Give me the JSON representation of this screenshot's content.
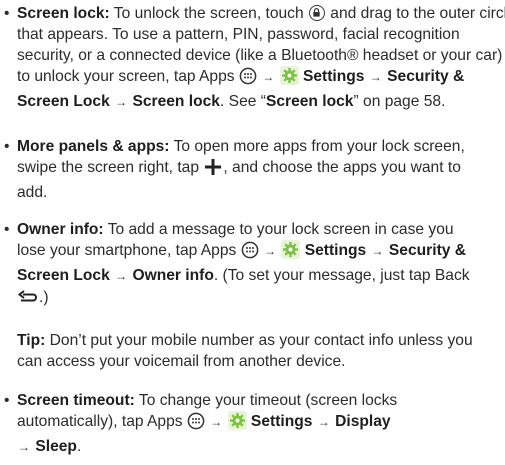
{
  "screen_lock": {
    "label": "Screen lock:",
    "t1": " To unlock the screen, touch ",
    "t2": " and drag to the outer circle that appears. To use a pattern, PIN, password, facial recognition security, or a connected device (like a Bluetooth® headset or your car) to unlock your screen, tap Apps ",
    "settings": "Settings",
    "security": "Security & Screen Lock",
    "screen_lock": "Screen lock",
    "see": ". See “",
    "ref": "Screen lock",
    "after_ref": "” on page 58."
  },
  "more_panels": {
    "label": "More panels & apps:",
    "t1": " To open more apps from your lock screen, swipe the screen right, tap ",
    "t2": ", and choose the apps you want to add."
  },
  "owner_info": {
    "label": "Owner info:",
    "t1": " To add a message to your lock screen in case you lose your smartphone, tap Apps ",
    "settings": "Settings",
    "security": "Security & Screen Lock",
    "owner": "Owner info",
    "t2": ". (To set your message, just tap Back ",
    "t3": ".)"
  },
  "tip": {
    "label": "Tip:",
    "text": " Don’t put your mobile number as your contact info unless you can access your voicemail from another device."
  },
  "screen_timeout": {
    "label": "Screen timeout:",
    "t1": " To change your timeout (screen locks automatically), tap Apps ",
    "settings": "Settings",
    "display": "Display",
    "sleep": "Sleep",
    "end": "."
  },
  "symbols": {
    "bullet": "•",
    "arrow": "→"
  },
  "icons": [
    "lock-circle-icon",
    "apps-icon",
    "settings-gear-icon",
    "plus-icon",
    "back-icon"
  ],
  "colors": {
    "text": "#2b2b2b",
    "settings_gear": "#7cc242"
  }
}
